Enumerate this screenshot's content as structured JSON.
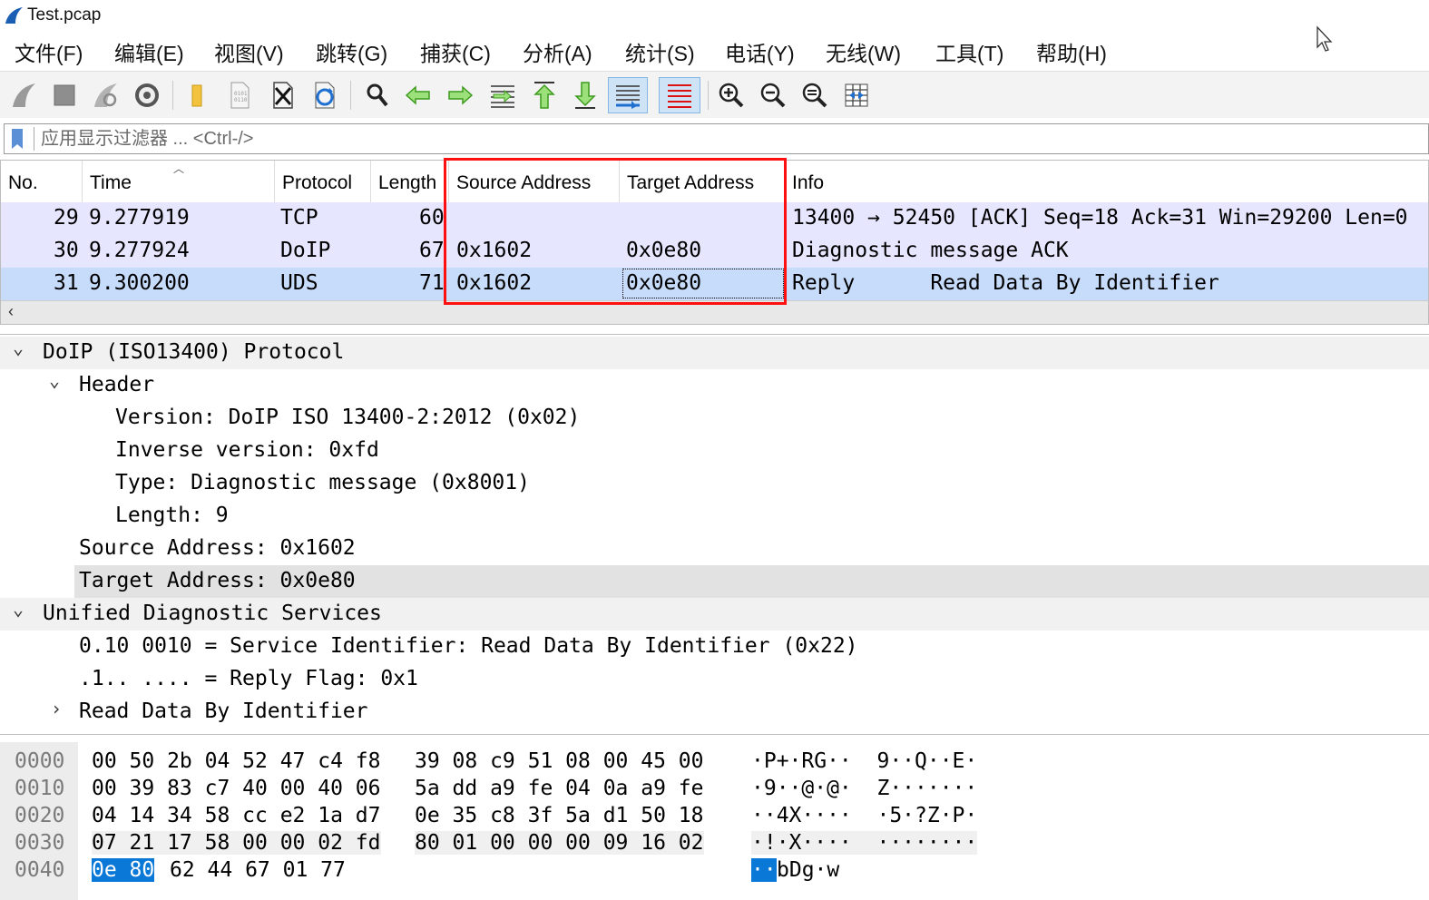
{
  "window": {
    "title": "Test.pcap"
  },
  "menu": [
    "文件(F)",
    "编辑(E)",
    "视图(V)",
    "跳转(G)",
    "捕获(C)",
    "分析(A)",
    "统计(S)",
    "电话(Y)",
    "无线(W)",
    "工具(T)",
    "帮助(H)"
  ],
  "toolbar": [
    "start-capture-icon",
    "stop-capture-icon",
    "restart-capture-icon",
    "capture-options-icon",
    "open-file-icon",
    "save-file-icon",
    "close-file-icon",
    "reload-file-icon",
    "find-packet-icon",
    "go-back-icon",
    "go-forward-icon",
    "go-to-packet-icon",
    "first-packet-icon",
    "last-packet-icon",
    "autoscroll-icon",
    "colorize-icon",
    "zoom-in-icon",
    "zoom-out-icon",
    "zoom-normal-icon",
    "resize-columns-icon"
  ],
  "filter": {
    "placeholder": "应用显示过滤器 ... <Ctrl-/>"
  },
  "columns": {
    "no": "No.",
    "time": "Time",
    "protocol": "Protocol",
    "length": "Length",
    "source": "Source Address",
    "target": "Target Address",
    "info": "Info"
  },
  "packets": [
    {
      "no": "29",
      "time": "9.277919",
      "protocol": "TCP",
      "length": "60",
      "source": "",
      "target": "",
      "info": "13400 → 52450 [ACK] Seq=18 Ack=31 Win=29200 Len=0"
    },
    {
      "no": "30",
      "time": "9.277924",
      "protocol": "DoIP",
      "length": "67",
      "source": "0x1602",
      "target": "0x0e80",
      "info": "Diagnostic message ACK"
    },
    {
      "no": "31",
      "time": "9.300200",
      "protocol": "UDS",
      "length": "71",
      "source": "0x1602",
      "target": "0x0e80",
      "info": "Reply      Read Data By Identifier"
    }
  ],
  "details": {
    "doip": "DoIP (ISO13400) Protocol",
    "header": "Header",
    "version": "Version: DoIP ISO 13400-2:2012 (0x02)",
    "inverse": "Inverse version: 0xfd",
    "type": "Type: Diagnostic message (0x8001)",
    "length": "Length: 9",
    "source": "Source Address: 0x1602",
    "target": "Target Address: 0x0e80",
    "uds": "Unified Diagnostic Services",
    "sid": "0.10 0010 = Service Identifier: Read Data By Identifier (0x22)",
    "reply": ".1.. .... = Reply Flag: 0x1",
    "rdbi": "Read Data By Identifier"
  },
  "bytes": [
    {
      "offset": "0000",
      "hex_a": "00 50 2b 04 52 47 c4 f8",
      "hex_b": "39 08 c9 51 08 00 45 00",
      "ascii": "·P+·RG··  9··Q··E·"
    },
    {
      "offset": "0010",
      "hex_a": "00 39 83 c7 40 00 40 06",
      "hex_b": "5a dd a9 fe 04 0a a9 fe",
      "ascii": "·9··@·@·  Z·······"
    },
    {
      "offset": "0020",
      "hex_a": "04 14 34 58 cc e2 1a d7",
      "hex_b": "0e 35 c8 3f 5a d1 50 18",
      "ascii": "··4X····  ·5·?Z·P·"
    },
    {
      "offset": "0030",
      "hex_a": "07 21 17 58 00 00 02 fd",
      "hex_b": "80 01 00 00 00 09 16 02",
      "ascii": "·!·X····  ········"
    },
    {
      "offset": "0040",
      "hex_sel": "0e 80",
      "hex_rest": "62 44 67 01 77",
      "ascii_sel": "··",
      "ascii_rest": "bDg·w"
    }
  ]
}
